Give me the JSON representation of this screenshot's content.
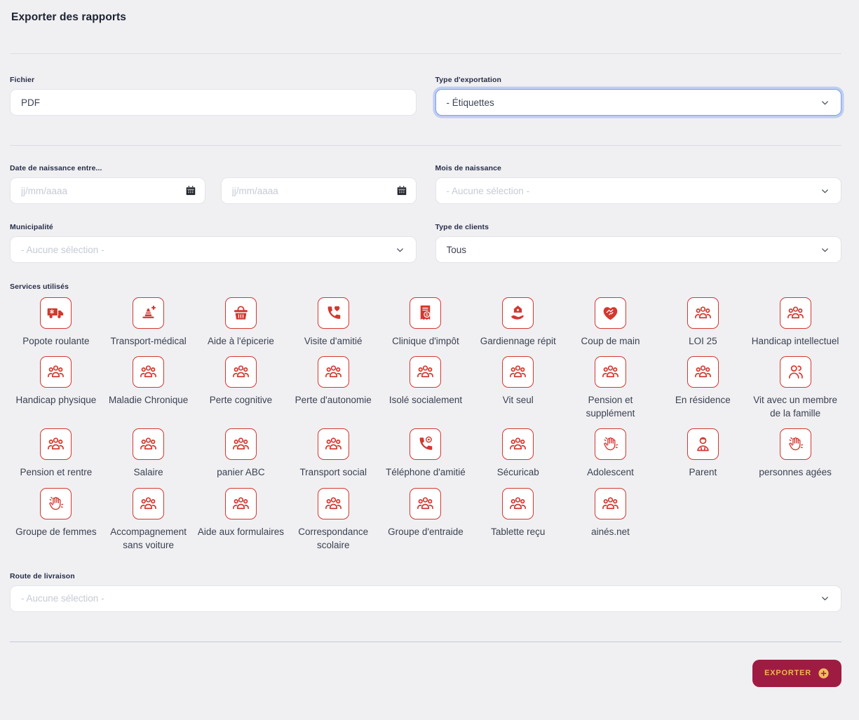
{
  "page": {
    "title": "Exporter des rapports"
  },
  "form": {
    "fichier": {
      "label": "Fichier",
      "value": "PDF"
    },
    "type_exportation": {
      "label": "Type d'exportation",
      "value": "- Étiquettes"
    },
    "date_naissance": {
      "label": "Date de naissance entre...",
      "placeholder_from": "jj/mm/aaaa",
      "placeholder_to": "jj/mm/aaaa"
    },
    "mois_naissance": {
      "label": "Mois de naissance",
      "value": "- Aucune sélection -"
    },
    "municipalite": {
      "label": "Municipalité",
      "value": "- Aucune sélection -"
    },
    "type_clients": {
      "label": "Type de clients",
      "value": "Tous"
    },
    "route_livraison": {
      "label": "Route de livraison",
      "value": "- Aucune sélection -"
    }
  },
  "services": {
    "label": "Services utilisés",
    "items": [
      {
        "label": "Popote roulante",
        "icon": "delivery-truck-icon"
      },
      {
        "label": "Transport-médical",
        "icon": "traffic-cone-plus-icon"
      },
      {
        "label": "Aide à l'épicerie",
        "icon": "grocery-basket-icon"
      },
      {
        "label": "Visite d'amitié",
        "icon": "phone-heart-icon"
      },
      {
        "label": "Clinique d'impôt",
        "icon": "receipt-dollar-icon"
      },
      {
        "label": "Gardiennage répit",
        "icon": "hand-house-icon"
      },
      {
        "label": "Coup de main",
        "icon": "handshake-heart-icon"
      },
      {
        "label": "LOI 25",
        "icon": "group-icon"
      },
      {
        "label": "Handicap intellectuel",
        "icon": "group-icon"
      },
      {
        "label": "Handicap physique",
        "icon": "group-icon"
      },
      {
        "label": "Maladie Chronique",
        "icon": "group-icon"
      },
      {
        "label": "Perte cognitive",
        "icon": "group-icon"
      },
      {
        "label": "Perte d'autonomie",
        "icon": "group-icon"
      },
      {
        "label": "Isolé socialement",
        "icon": "group-icon"
      },
      {
        "label": "Vit seul",
        "icon": "group-icon"
      },
      {
        "label": "Pension et supplément",
        "icon": "group-icon"
      },
      {
        "label": "En résidence",
        "icon": "group-icon"
      },
      {
        "label": "Vit avec un membre de la famille",
        "icon": "family-icon"
      },
      {
        "label": "Pension et rentre",
        "icon": "group-icon"
      },
      {
        "label": "Salaire",
        "icon": "group-icon"
      },
      {
        "label": "panier ABC",
        "icon": "group-icon"
      },
      {
        "label": "Transport social",
        "icon": "group-icon"
      },
      {
        "label": "Téléphone d'amitié",
        "icon": "phone-dial-icon"
      },
      {
        "label": "Sécuricab",
        "icon": "group-icon"
      },
      {
        "label": "Adolescent",
        "icon": "waving-hand-icon"
      },
      {
        "label": "Parent",
        "icon": "person-icon"
      },
      {
        "label": "personnes agées",
        "icon": "waving-hand-icon"
      },
      {
        "label": "Groupe de femmes",
        "icon": "waving-hand-icon"
      },
      {
        "label": "Accompagnement sans voiture",
        "icon": "group-icon"
      },
      {
        "label": "Aide aux formulaires",
        "icon": "group-icon"
      },
      {
        "label": "Correspondance scolaire",
        "icon": "group-icon"
      },
      {
        "label": "Groupe d'entraide",
        "icon": "group-icon"
      },
      {
        "label": "Tablette reçu",
        "icon": "group-icon"
      },
      {
        "label": "ainés.net",
        "icon": "group-icon"
      }
    ]
  },
  "footer": {
    "export_label": "EXPORTER"
  },
  "colors": {
    "accent_red": "#d2382f",
    "button_maroon": "#9e1c41",
    "button_gold": "#ecb84f",
    "focus_blue": "#7d9df0"
  }
}
